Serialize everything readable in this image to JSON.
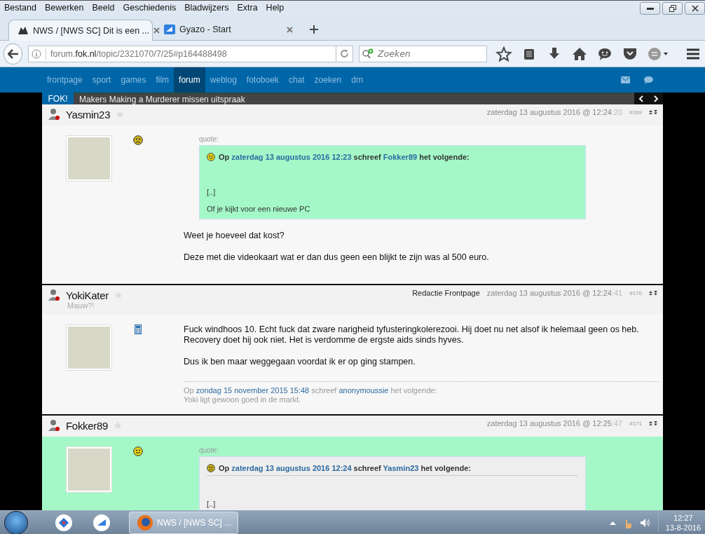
{
  "menu_bar": [
    "Bestand",
    "Bewerken",
    "Beeld",
    "Geschiedenis",
    "Bladwijzers",
    "Extra",
    "Help"
  ],
  "tabs": [
    {
      "title": "NWS / [NWS SC] Dit is een ...",
      "selected": true
    },
    {
      "title": "Gyazo - Start",
      "selected": false
    }
  ],
  "address": {
    "prefix": "forum.",
    "domain": "fok.nl",
    "path": "/topic/2321070/7/25#p164488498"
  },
  "search": {
    "placeholder": "Zoeken"
  },
  "site_nav": [
    {
      "label": "frontpage",
      "selected": false
    },
    {
      "label": "sport",
      "selected": false
    },
    {
      "label": "games",
      "selected": false
    },
    {
      "label": "film",
      "selected": false
    },
    {
      "label": "forum",
      "selected": true
    },
    {
      "label": "weblog",
      "selected": false
    },
    {
      "label": "fotoboek",
      "selected": false
    },
    {
      "label": "chat",
      "selected": false
    },
    {
      "label": "zoeken",
      "selected": false
    },
    {
      "label": "dm",
      "selected": false
    }
  ],
  "ticker": {
    "badge": "FOK!",
    "headline": "Makers Making a Murderer missen uitspraak"
  },
  "posts": [
    {
      "author": "Yasmin23",
      "date": "zaterdag 13 augustus 2016 @ 12:24",
      "seconds": ":20",
      "number": "#169",
      "highlighted": false,
      "mood": {
        "kind": "sad"
      },
      "quote": {
        "label": "quote:",
        "mood": {
          "kind": "happy"
        },
        "prefix": "Op",
        "date": "zaterdag 13 augustus 2016 12:23",
        "verb": "schreef",
        "author": "Fokker89",
        "suffix": "het volgende:",
        "lines": [
          "[..]",
          "Of je kijkt voor een nieuwe PC"
        ]
      },
      "paragraphs": [
        [
          "Weet je hoeveel dat kost?"
        ],
        [
          "Deze met die videokaart wat er dan dus geen een blijkt te zijn was al 500 euro."
        ]
      ]
    },
    {
      "author": "YokiKater",
      "subtitle": "Mauw?!",
      "role": "Redactie Frontpage",
      "date": "zaterdag 13 augustus 2016 @ 12:24",
      "seconds": ":41",
      "number": "#170",
      "highlighted": false,
      "mood": {
        "kind": "device"
      },
      "paragraphs": [
        [
          "Fuck windhoos 10. Echt fuck dat zware narigheid tyfusteringkolerezooi. Hij doet nu net alsof ik helemaal geen os heb.",
          "Recovery doet hij ook niet. Het is verdomme de ergste aids sinds hyves."
        ],
        [
          "Dus ik ben maar weggegaan voordat ik er op ging stampen."
        ]
      ],
      "signature": {
        "prefix": "Op",
        "date": "zondag 15 november 2015 15:48",
        "verb": "schreef",
        "author": "anonymoussie",
        "suffix": "het volgende:",
        "text": "Yoki ligt gewoon goed in de markt."
      }
    },
    {
      "author": "Fokker89",
      "date": "zaterdag 13 augustus 2016 @ 12:25",
      "seconds": ":47",
      "number": "#171",
      "highlighted": true,
      "mood": {
        "kind": "happy"
      },
      "quote": {
        "label": "quote:",
        "mood": {
          "kind": "sad"
        },
        "prefix": "Op",
        "date": "zaterdag 13 augustus 2016 12:24",
        "verb": "schreef",
        "author": "Yasmin23",
        "suffix": "het volgende:",
        "lines": [
          "[..]"
        ]
      }
    }
  ],
  "taskbar": {
    "task": "NWS / [NWS SC] ...",
    "time": "12:27",
    "date": "13-8-2016"
  }
}
